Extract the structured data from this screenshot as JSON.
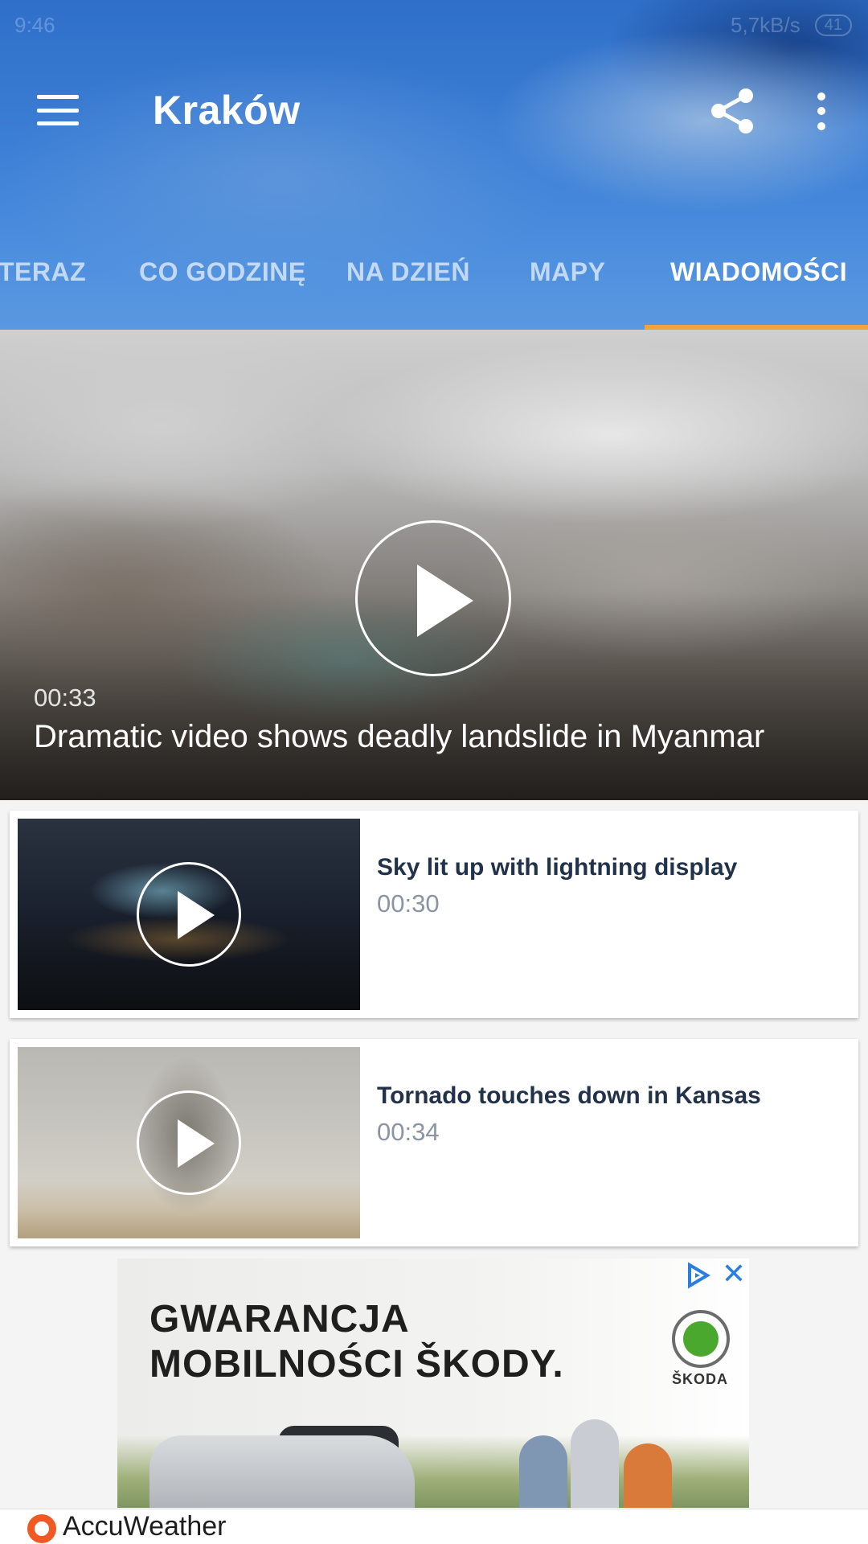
{
  "status_bar": {
    "time": "9:46",
    "speed": "5,7kB/s",
    "battery": "41"
  },
  "header": {
    "title": "Kraków",
    "menu_icon": "menu-icon",
    "share_icon": "share-icon",
    "more_icon": "more-vert-icon"
  },
  "tabs": [
    {
      "label": "TERAZ",
      "active": false
    },
    {
      "label": "CO GODZINĘ",
      "active": false
    },
    {
      "label": "NA DZIEŃ",
      "active": false
    },
    {
      "label": "MAPY",
      "active": false
    },
    {
      "label": "WIADOMOŚCI",
      "active": true
    }
  ],
  "hero": {
    "duration": "00:33",
    "title": "Dramatic video shows deadly landslide in Myanmar"
  },
  "videos": [
    {
      "title": "Sky lit up with lightning display",
      "duration": "00:30"
    },
    {
      "title": "Tornado touches down in Kansas",
      "duration": "00:34"
    }
  ],
  "ad": {
    "headline_line1": "GWARANCJA",
    "headline_line2": "MOBILNOŚCI ŠKODY.",
    "brand": "ŠKODA",
    "close": "✕"
  },
  "footer": {
    "brand": "AccuWeather"
  },
  "colors": {
    "tab_indicator": "#f2a33a",
    "card_title": "#22324a",
    "brand_orange": "#f05a22"
  }
}
